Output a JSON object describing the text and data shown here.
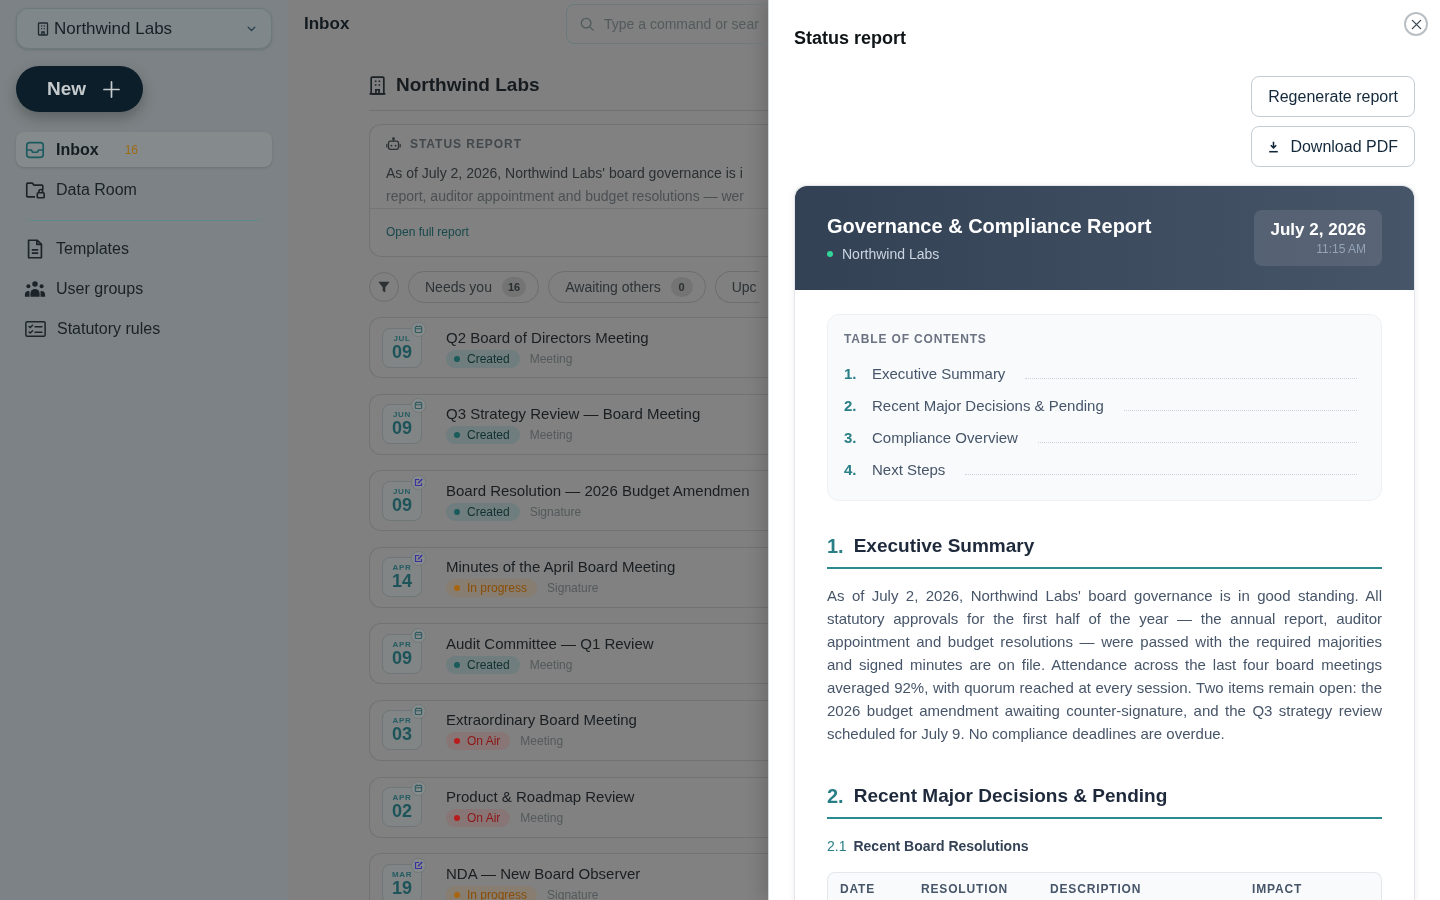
{
  "sidebar": {
    "org_selector": {
      "label": "Northwind Labs"
    },
    "new_button": {
      "label": "New"
    },
    "nav_primary": [
      {
        "label": "Inbox",
        "count": "16",
        "selected": true
      },
      {
        "label": "Data Room",
        "selected": false
      }
    ],
    "nav_secondary": [
      {
        "label": "Templates",
        "selected": false
      },
      {
        "label": "User groups",
        "selected": false
      },
      {
        "label": "Statutory rules",
        "selected": false
      }
    ]
  },
  "main": {
    "title": "Inbox",
    "search": {
      "placeholder": "Type a command or sear"
    },
    "org_heading": "Northwind Labs",
    "status_card": {
      "label": "STATUS REPORT",
      "lines": [
        "As of July 2, 2026, Northwind Labs' board governance is i",
        "report, auditor appointment and budget resolutions — wer"
      ],
      "link": "Open full report"
    },
    "filters": [
      {
        "label": "Needs you",
        "count": "16"
      },
      {
        "label": "Awaiting others",
        "count": "0"
      },
      {
        "label": "Upc"
      }
    ],
    "items": [
      {
        "month": "JUL",
        "day": "09",
        "title": "Q2 Board of Directors Meeting",
        "status": {
          "label": "Created",
          "kind": "created"
        },
        "type": "Meeting",
        "kind": "meeting"
      },
      {
        "month": "JUN",
        "day": "09",
        "title": "Q3 Strategy Review — Board Meeting",
        "status": {
          "label": "Created",
          "kind": "created"
        },
        "type": "Meeting",
        "kind": "meeting"
      },
      {
        "month": "JUN",
        "day": "09",
        "title": "Board Resolution — 2026 Budget Amendmen",
        "status": {
          "label": "Created",
          "kind": "created"
        },
        "type": "Signature",
        "kind": "signature"
      },
      {
        "month": "APR",
        "day": "14",
        "title": "Minutes of the April Board Meeting",
        "status": {
          "label": "In progress",
          "kind": "in_progress"
        },
        "type": "Signature",
        "kind": "signature"
      },
      {
        "month": "APR",
        "day": "09",
        "title": "Audit Committee — Q1 Review",
        "status": {
          "label": "Created",
          "kind": "created"
        },
        "type": "Meeting",
        "kind": "meeting"
      },
      {
        "month": "APR",
        "day": "03",
        "title": "Extraordinary Board Meeting",
        "status": {
          "label": "On Air",
          "kind": "on_air"
        },
        "type": "Meeting",
        "kind": "meeting"
      },
      {
        "month": "APR",
        "day": "02",
        "title": "Product & Roadmap Review",
        "status": {
          "label": "On Air",
          "kind": "on_air"
        },
        "type": "Meeting",
        "kind": "meeting"
      },
      {
        "month": "MAR",
        "day": "19",
        "title": "NDA — New Board Observer",
        "status": {
          "label": "In progress",
          "kind": "in_progress"
        },
        "type": "Signature",
        "kind": "signature"
      }
    ]
  },
  "report_panel": {
    "title": "Status report",
    "regenerate_button": {
      "label": "Regenerate report"
    },
    "download_button": {
      "label": "Download PDF"
    },
    "report": {
      "title": "Governance & Compliance Report",
      "organization": "Northwind Labs",
      "date": "July 2, 2026",
      "time": "11:15 AM",
      "toc_title": "TABLE OF CONTENTS",
      "toc": [
        {
          "number": "1.",
          "label": "Executive Summary"
        },
        {
          "number": "2.",
          "label": "Recent Major Decisions & Pending"
        },
        {
          "number": "3.",
          "label": "Compliance Overview"
        },
        {
          "number": "4.",
          "label": "Next Steps"
        }
      ],
      "sections": [
        {
          "number": "1.",
          "title": "Executive Summary",
          "paragraphs": [
            "As of July 2, 2026, Northwind Labs' board governance is in good standing. All statutory approvals for the first half of the year — the annual report, auditor appointment and budget resolutions — were passed with the required majorities and signed minutes are on file. Attendance across the last four board meetings averaged 92%, with quorum reached at every session. Two items remain open: the 2026 budget amendment awaiting counter-signature, and the Q3 strategy review scheduled for July 9. No compliance deadlines are overdue."
          ]
        },
        {
          "number": "2.",
          "title": "Recent Major Decisions & Pending",
          "subsections": [
            {
              "number": "2.1",
              "title": "Recent Board Resolutions",
              "table": {
                "columns": [
                  "DATE",
                  "RESOLUTION",
                  "DESCRIPTION",
                  "IMPACT"
                ]
              }
            }
          ]
        }
      ]
    }
  }
}
